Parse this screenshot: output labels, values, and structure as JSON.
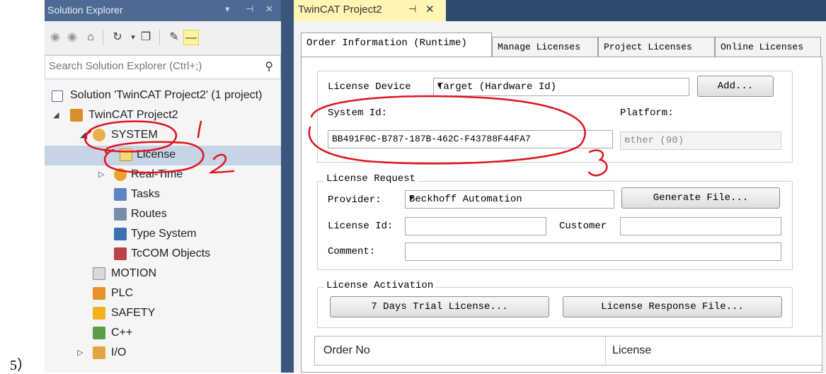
{
  "page_label": "5）",
  "solution_explorer": {
    "title": "Solution Explorer",
    "title_controls": [
      "▾",
      "⊣",
      "✕"
    ],
    "search_placeholder": "Search Solution Explorer (Ctrl+;)",
    "tree": {
      "solution": "Solution 'TwinCAT Project2' (1 project)",
      "project": "TwinCAT Project2",
      "system": "SYSTEM",
      "license": "License",
      "realtime": "Real-Time",
      "tasks": "Tasks",
      "routes": "Routes",
      "type_system": "Type System",
      "tccom": "TcCOM Objects",
      "motion": "MOTION",
      "plc": "PLC",
      "safety": "SAFETY",
      "cpp": "C++",
      "io": "I/O"
    }
  },
  "document": {
    "tab_title": "TwinCAT Project2",
    "tab_pin": "⊣",
    "tab_close": "✕",
    "tabs": [
      "Order Information (Runtime)",
      "Manage Licenses",
      "Project Licenses",
      "Online Licenses"
    ],
    "license_device": {
      "label": "License Device",
      "value": "Target (Hardware Id)",
      "add_button": "Add..."
    },
    "system_id": {
      "label": "System Id:",
      "value": "BB491F0C-B787-187B-462C-F43788F44FA7"
    },
    "platform": {
      "label": "Platform:",
      "value": "other (90)"
    },
    "license_request": {
      "legend": "License Request",
      "provider_label": "Provider:",
      "provider_value": "Beckhoff Automation",
      "generate_button": "Generate File...",
      "license_id_label": "License Id:",
      "customer_label": "Customer",
      "comment_label": "Comment:"
    },
    "license_activation": {
      "legend": "License Activation",
      "trial_button": "7 Days Trial License...",
      "response_button": "License Response File..."
    },
    "table": {
      "columns": [
        "Order No",
        "License"
      ]
    }
  },
  "annotations": [
    "1",
    "2",
    "3"
  ],
  "colors": {
    "annotation_red": "#e0141e",
    "selection": "#c6d4e6",
    "title_bar": "#4e6a92",
    "tab_yellow": "#fff5b3"
  }
}
